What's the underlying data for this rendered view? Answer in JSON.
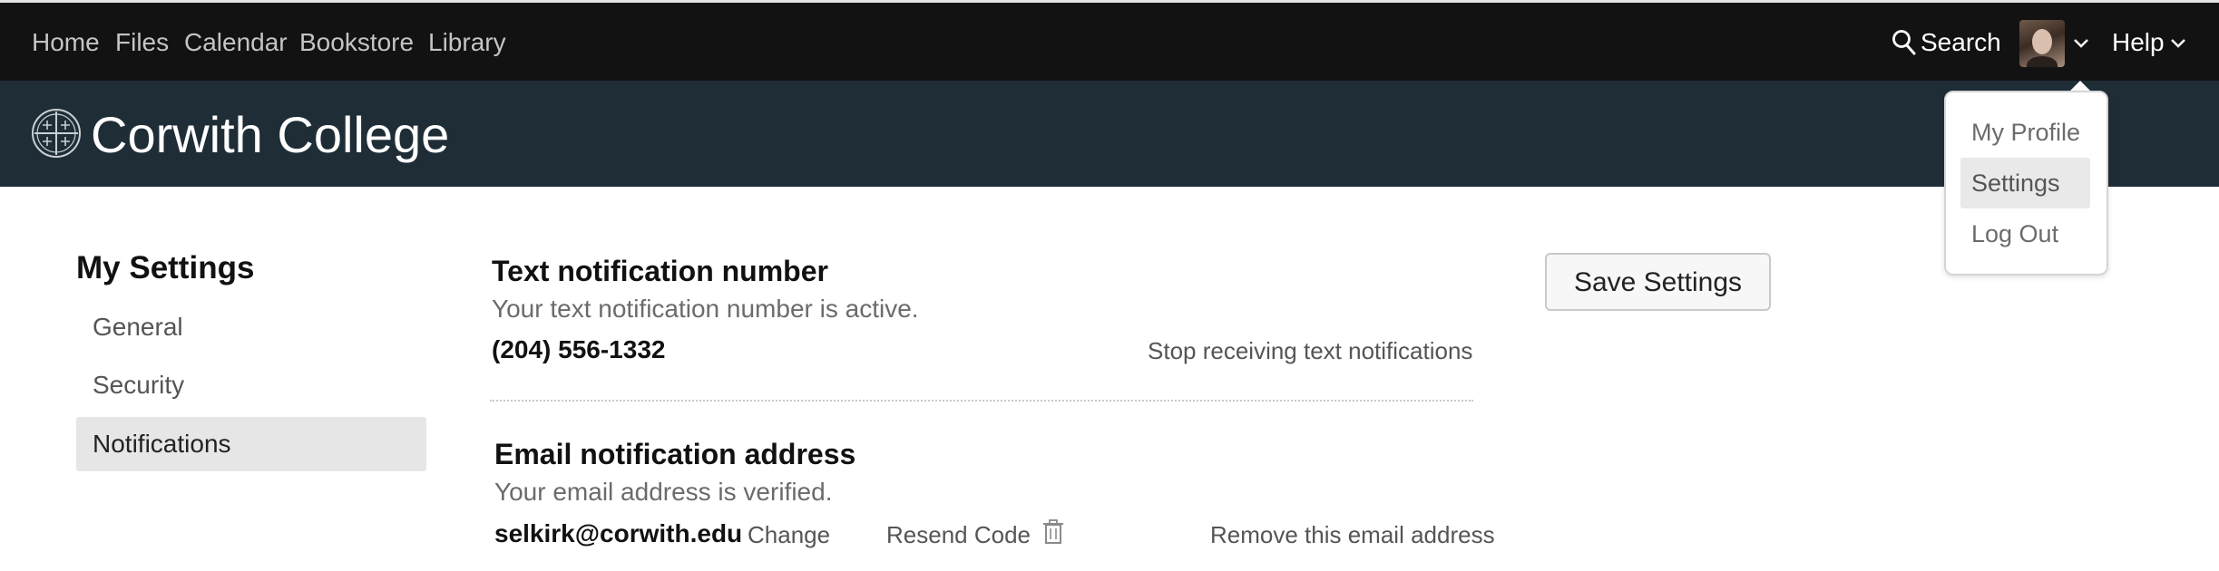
{
  "topnav": {
    "links": [
      "Home",
      "Files",
      "Calendar",
      "Bookstore",
      "Library"
    ],
    "search_label": "Search",
    "help_label": "Help"
  },
  "banner": {
    "title": "Corwith College"
  },
  "sidebar": {
    "title": "My Settings",
    "items": [
      {
        "label": "General"
      },
      {
        "label": "Security"
      },
      {
        "label": "Notifications"
      }
    ]
  },
  "text_notification": {
    "heading": "Text notification number",
    "status": "Your text notification number is active.",
    "number": "(204) 556-1332",
    "stop_link": "Stop receiving text notifications"
  },
  "email_notification": {
    "heading": "Email notification address",
    "status": "Your email address is verified.",
    "address": "selkirk@corwith.edu",
    "change_link": "Change",
    "resend_link": "Resend Code",
    "remove_link": "Remove this email address"
  },
  "save_button": "Save Settings",
  "user_menu": {
    "items": [
      {
        "label": "My Profile"
      },
      {
        "label": "Settings"
      },
      {
        "label": "Log Out"
      }
    ]
  }
}
